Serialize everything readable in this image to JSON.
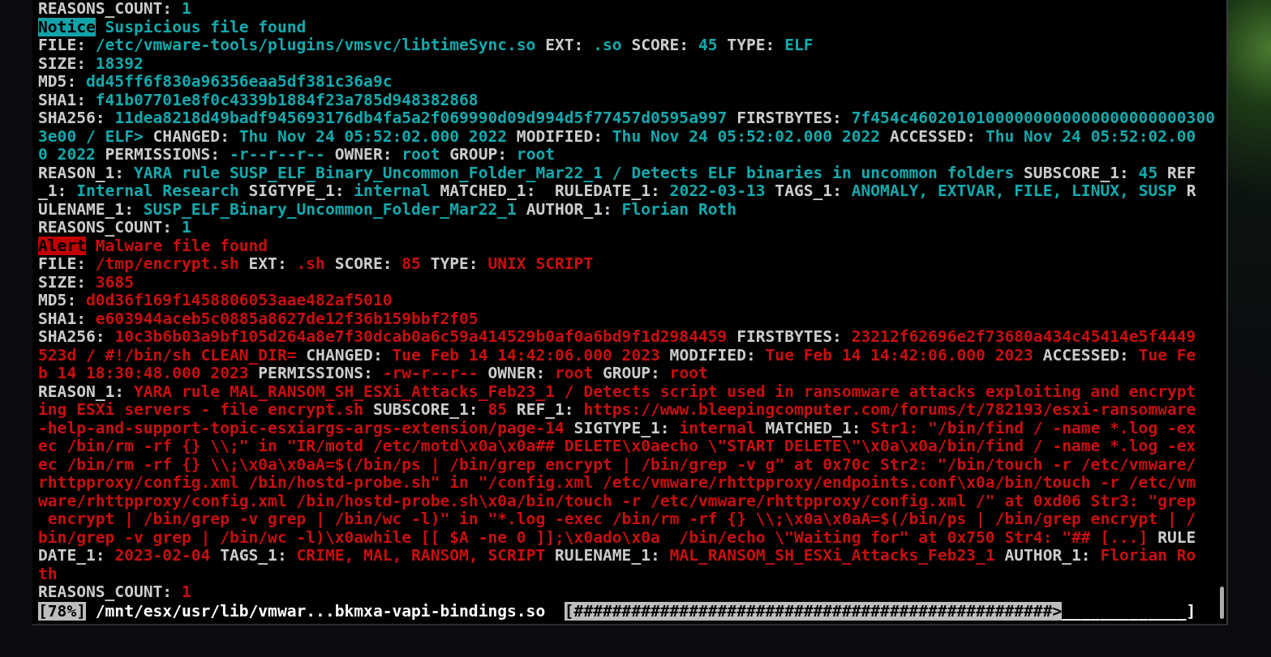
{
  "entries": [
    {
      "kind": "notice",
      "lines": [
        [
          {
            "kind": "key",
            "text": "REASONS_COUNT:"
          },
          {
            "kind": "value",
            "text": "1"
          }
        ]
      ]
    },
    {
      "kind": "notice",
      "lines": [
        [
          {
            "kind": "badge",
            "text": "Notice"
          },
          {
            "kind": "value",
            "text": "Suspicious file found"
          }
        ],
        [
          {
            "kind": "key",
            "text": "FILE:"
          },
          {
            "kind": "value",
            "text": "/etc/vmware-tools/plugins/vmsvc/libtimeSync.so"
          },
          {
            "kind": "key",
            "text": "EXT:"
          },
          {
            "kind": "value",
            "text": ".so"
          },
          {
            "kind": "key",
            "text": "SCORE:"
          },
          {
            "kind": "value",
            "text": "45"
          },
          {
            "kind": "key",
            "text": "TYPE:"
          },
          {
            "kind": "value",
            "text": "ELF"
          }
        ],
        [
          {
            "kind": "key",
            "text": "SIZE:"
          },
          {
            "kind": "value",
            "text": "18392"
          }
        ],
        [
          {
            "kind": "key",
            "text": "MD5:"
          },
          {
            "kind": "value",
            "text": "dd45ff6f830a96356eaa5df381c36a9c"
          }
        ],
        [
          {
            "kind": "key",
            "text": "SHA1:"
          },
          {
            "kind": "value",
            "text": "f41b07701e8f0c4339b1884f23a785d948382868"
          }
        ],
        [
          {
            "kind": "key",
            "text": "SHA256:"
          },
          {
            "kind": "value",
            "text": "11dea8218d49badf945693176db4fa5a2f069990d09d994d5f77457d0595a997"
          },
          {
            "kind": "key",
            "text": "FIRSTBYTES:"
          },
          {
            "kind": "value",
            "text": "7f454c46020101000000000000000000000300"
          }
        ],
        [
          {
            "kind": "value",
            "text": "3e00 / ELF>"
          },
          {
            "kind": "key",
            "text": "CHANGED:"
          },
          {
            "kind": "value",
            "text": "Thu Nov 24 05:52:02.000 2022"
          },
          {
            "kind": "key",
            "text": "MODIFIED:"
          },
          {
            "kind": "value",
            "text": "Thu Nov 24 05:52:02.000 2022"
          },
          {
            "kind": "key",
            "text": "ACCESSED:"
          },
          {
            "kind": "value",
            "text": "Thu Nov 24 05:52:02.00"
          }
        ],
        [
          {
            "kind": "value",
            "text": "0 2022"
          },
          {
            "kind": "key",
            "text": "PERMISSIONS:"
          },
          {
            "kind": "value",
            "text": "-r--r--r--"
          },
          {
            "kind": "key",
            "text": "OWNER:"
          },
          {
            "kind": "value",
            "text": "root"
          },
          {
            "kind": "key",
            "text": "GROUP:"
          },
          {
            "kind": "value",
            "text": "root"
          }
        ],
        [
          {
            "kind": "key",
            "text": "REASON_1:"
          },
          {
            "kind": "value",
            "text": "YARA rule SUSP_ELF_Binary_Uncommon_Folder_Mar22_1 / Detects ELF binaries in uncommon folders"
          },
          {
            "kind": "key",
            "text": "SUBSCORE_1:"
          },
          {
            "kind": "value",
            "text": "45"
          },
          {
            "kind": "key",
            "text": "REF"
          }
        ],
        [
          {
            "kind": "key",
            "text": "_1:"
          },
          {
            "kind": "value",
            "text": "Internal Research"
          },
          {
            "kind": "key",
            "text": "SIGTYPE_1:"
          },
          {
            "kind": "value",
            "text": "internal"
          },
          {
            "kind": "key",
            "text": "MATCHED_1: "
          },
          {
            "kind": "key",
            "text": "RULEDATE_1:"
          },
          {
            "kind": "value",
            "text": "2022-03-13"
          },
          {
            "kind": "key",
            "text": "TAGS_1:"
          },
          {
            "kind": "value",
            "text": "ANOMALY, EXTVAR, FILE, LINUX, SUSP"
          },
          {
            "kind": "key",
            "text": "R"
          }
        ],
        [
          {
            "kind": "key",
            "text": "ULENAME_1:"
          },
          {
            "kind": "value",
            "text": "SUSP_ELF_Binary_Uncommon_Folder_Mar22_1"
          },
          {
            "kind": "key",
            "text": "AUTHOR_1:"
          },
          {
            "kind": "value",
            "text": "Florian Roth"
          }
        ],
        [
          {
            "kind": "key",
            "text": "REASONS_COUNT:"
          },
          {
            "kind": "value",
            "text": "1"
          }
        ]
      ]
    },
    {
      "kind": "alert",
      "lines": [
        [
          {
            "kind": "badge",
            "text": "Alert"
          },
          {
            "kind": "value",
            "text": "Malware file found"
          }
        ],
        [
          {
            "kind": "key",
            "text": "FILE:"
          },
          {
            "kind": "value",
            "text": "/tmp/encrypt.sh"
          },
          {
            "kind": "key",
            "text": "EXT:"
          },
          {
            "kind": "value",
            "text": ".sh"
          },
          {
            "kind": "key",
            "text": "SCORE:"
          },
          {
            "kind": "value",
            "text": "85"
          },
          {
            "kind": "key",
            "text": "TYPE:"
          },
          {
            "kind": "value",
            "text": "UNIX SCRIPT"
          }
        ],
        [
          {
            "kind": "key",
            "text": "SIZE:"
          },
          {
            "kind": "value",
            "text": "3685"
          }
        ],
        [
          {
            "kind": "key",
            "text": "MD5:"
          },
          {
            "kind": "value",
            "text": "d0d36f169f1458806053aae482af5010"
          }
        ],
        [
          {
            "kind": "key",
            "text": "SHA1:"
          },
          {
            "kind": "value",
            "text": "e603944aceb5c0885a8627de12f36b159bbf2f05"
          }
        ],
        [
          {
            "kind": "key",
            "text": "SHA256:"
          },
          {
            "kind": "value",
            "text": "10c3b6b03a9bf105d264a8e7f30dcab0a6c59a414529b0af0a6bd9f1d2984459"
          },
          {
            "kind": "key",
            "text": "FIRSTBYTES:"
          },
          {
            "kind": "value",
            "text": "23212f62696e2f73680a434c45414e5f4449"
          }
        ],
        [
          {
            "kind": "value",
            "text": "523d / #!/bin/sh CLEAN_DIR="
          },
          {
            "kind": "key",
            "text": "CHANGED:"
          },
          {
            "kind": "value",
            "text": "Tue Feb 14 14:42:06.000 2023"
          },
          {
            "kind": "key",
            "text": "MODIFIED:"
          },
          {
            "kind": "value",
            "text": "Tue Feb 14 14:42:06.000 2023"
          },
          {
            "kind": "key",
            "text": "ACCESSED:"
          },
          {
            "kind": "value",
            "text": "Tue Fe"
          }
        ],
        [
          {
            "kind": "value",
            "text": "b 14 18:30:48.000 2023"
          },
          {
            "kind": "key",
            "text": "PERMISSIONS:"
          },
          {
            "kind": "value",
            "text": "-rw-r--r--"
          },
          {
            "kind": "key",
            "text": "OWNER:"
          },
          {
            "kind": "value",
            "text": "root"
          },
          {
            "kind": "key",
            "text": "GROUP:"
          },
          {
            "kind": "value",
            "text": "root"
          }
        ],
        [
          {
            "kind": "key",
            "text": "REASON_1:"
          },
          {
            "kind": "value",
            "text": "YARA rule MAL_RANSOM_SH_ESXi_Attacks_Feb23_1 / Detects script used in ransomware attacks exploiting and encrypt"
          }
        ],
        [
          {
            "kind": "value",
            "text": "ing ESXi servers - file encrypt.sh"
          },
          {
            "kind": "key",
            "text": "SUBSCORE_1:"
          },
          {
            "kind": "value",
            "text": "85"
          },
          {
            "kind": "key",
            "text": "REF_1:"
          },
          {
            "kind": "value",
            "text": "https://www.bleepingcomputer.com/forums/t/782193/esxi-ransomware"
          }
        ],
        [
          {
            "kind": "value",
            "text": "-help-and-support-topic-esxiargs-args-extension/page-14"
          },
          {
            "kind": "key",
            "text": "SIGTYPE_1:"
          },
          {
            "kind": "value",
            "text": "internal"
          },
          {
            "kind": "key",
            "text": "MATCHED_1:"
          },
          {
            "kind": "value",
            "text": "Str1: \"/bin/find / -name *.log -ex"
          }
        ],
        [
          {
            "kind": "value",
            "text": "ec /bin/rm -rf {} \\\\;\" in \"IR/motd /etc/motd\\x0a\\x0a## DELETE\\x0aecho \\\"START DELETE\\\"\\x0a\\x0a/bin/find / -name *.log -ex"
          }
        ],
        [
          {
            "kind": "value",
            "text": "ec /bin/rm -rf {} \\\\;\\x0a\\x0aA=$(/bin/ps | /bin/grep encrypt | /bin/grep -v g\" at 0x70c Str2: \"/bin/touch -r /etc/vmware/"
          }
        ],
        [
          {
            "kind": "value",
            "text": "rhttpproxy/config.xml /bin/hostd-probe.sh\" in \"/config.xml /etc/vmware/rhttpproxy/endpoints.conf\\x0a/bin/touch -r /etc/vm"
          }
        ],
        [
          {
            "kind": "value",
            "text": "ware/rhttpproxy/config.xml /bin/hostd-probe.sh\\x0a/bin/touch -r /etc/vmware/rhttpproxy/config.xml /\" at 0xd06 Str3: \"grep"
          }
        ],
        [
          {
            "kind": "value",
            "text": " encrypt | /bin/grep -v grep | /bin/wc -l)\" in \"*.log -exec /bin/rm -rf {} \\\\;\\x0a\\x0aA=$(/bin/ps | /bin/grep encrypt | /"
          }
        ],
        [
          {
            "kind": "value",
            "text": "bin/grep -v grep | /bin/wc -l)\\x0awhile [[ $A -ne 0 ]];\\x0ado\\x0a  /bin/echo \\\"Waiting for\" at 0x750 Str4: \"## [...]"
          },
          {
            "kind": "key",
            "text": "RULE"
          }
        ],
        [
          {
            "kind": "key",
            "text": "DATE_1:"
          },
          {
            "kind": "value",
            "text": "2023-02-04"
          },
          {
            "kind": "key",
            "text": "TAGS_1:"
          },
          {
            "kind": "value",
            "text": "CRIME, MAL, RANSOM, SCRIPT"
          },
          {
            "kind": "key",
            "text": "RULENAME_1:"
          },
          {
            "kind": "value",
            "text": "MAL_RANSOM_SH_ESXi_Attacks_Feb23_1"
          },
          {
            "kind": "key",
            "text": "AUTHOR_1:"
          },
          {
            "kind": "value",
            "text": "Florian Ro"
          }
        ],
        [
          {
            "kind": "value",
            "text": "th"
          }
        ],
        [
          {
            "kind": "key",
            "text": "REASONS_COUNT:"
          },
          {
            "kind": "value",
            "text": "1"
          }
        ]
      ]
    }
  ],
  "progress": {
    "percent": "[78%]",
    "path": "/mnt/esx/usr/lib/vmwar...bkmxa-vapi-bindings.so",
    "bar_filled": "[##################################################>",
    "bar_rest": "_____________]"
  }
}
